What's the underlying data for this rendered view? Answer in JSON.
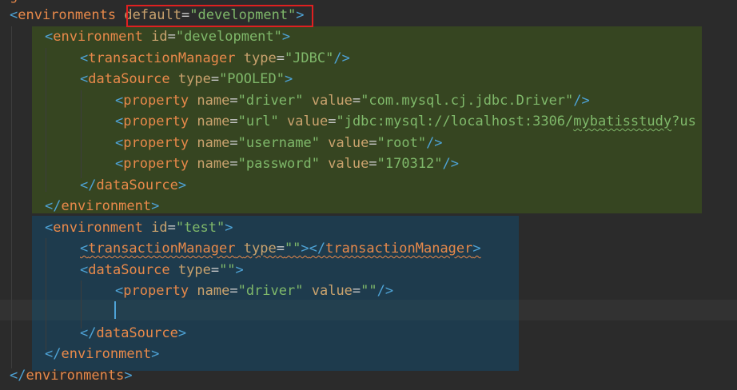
{
  "colors": {
    "background": "#2b2b2b",
    "tag": "#e8894a",
    "bracket": "#4ea3d6",
    "attribute": "#c9a26d",
    "string": "#7fb86a",
    "dev_block": "#364521",
    "test_block": "#1e3b4d",
    "highlight_border": "#e02020"
  },
  "code": {
    "top_fragment": "g",
    "l1": {
      "lt": "<",
      "tag": "environments",
      "sp": " ",
      "attr": "default",
      "eq": "=",
      "val": "\"development\"",
      "gt": ">"
    },
    "l2": {
      "lt": "<",
      "tag": "environment",
      "attr": "id",
      "eq": "=",
      "val": "\"development\"",
      "gt": ">"
    },
    "l3": {
      "lt": "<",
      "tag": "transactionManager",
      "attr": "type",
      "eq": "=",
      "val": "\"JDBC\"",
      "gt": "/>"
    },
    "l4": {
      "lt": "<",
      "tag": "dataSource",
      "attr": "type",
      "eq": "=",
      "val": "\"POOLED\"",
      "gt": ">"
    },
    "l5": {
      "lt": "<",
      "tag": "property",
      "a1": "name",
      "v1": "\"driver\"",
      "a2": "value",
      "v2": "\"com.mysql.cj.jdbc.Driver\"",
      "gt": "/>"
    },
    "l6": {
      "lt": "<",
      "tag": "property",
      "a1": "name",
      "v1": "\"url\"",
      "a2": "value",
      "v2a": "\"jdbc:mysql://localhost:3306/",
      "v2b": "mybatisstudy",
      "v2c": "?us"
    },
    "l7": {
      "lt": "<",
      "tag": "property",
      "a1": "name",
      "v1": "\"username\"",
      "a2": "value",
      "v2": "\"root\"",
      "gt": "/>"
    },
    "l8": {
      "lt": "<",
      "tag": "property",
      "a1": "name",
      "v1": "\"password\"",
      "a2": "value",
      "v2": "\"170312\"",
      "gt": "/>"
    },
    "l9": {
      "lt": "</",
      "tag": "dataSource",
      "gt": ">"
    },
    "l10": {
      "lt": "</",
      "tag": "environment",
      "gt": ">"
    },
    "l11": {
      "lt": "<",
      "tag": "environment",
      "attr": "id",
      "eq": "=",
      "val": "\"test\"",
      "gt": ">"
    },
    "l12": {
      "lt": "<",
      "tag": "transactionManager",
      "attr": "type",
      "eq": "=",
      "val": "\"\"",
      "gt": ">",
      "clt": "</",
      "ctag": "transactionManager",
      "cgt": ">"
    },
    "l13": {
      "lt": "<",
      "tag": "dataSource",
      "attr": "type",
      "eq": "=",
      "val": "\"\"",
      "gt": ">"
    },
    "l14": {
      "lt": "<",
      "tag": "property",
      "a1": "name",
      "v1": "\"driver\"",
      "a2": "value",
      "v2": "\"\"",
      "gt": "/>"
    },
    "l16": {
      "lt": "</",
      "tag": "dataSource",
      "gt": ">"
    },
    "l17": {
      "lt": "</",
      "tag": "environment",
      "gt": ">"
    },
    "l18": {
      "lt": "</",
      "tag": "environments",
      "gt": ">"
    }
  }
}
